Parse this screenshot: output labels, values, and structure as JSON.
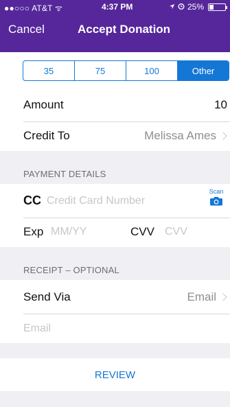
{
  "status_bar": {
    "carrier": "●●○○○ AT&T ᯤ",
    "time": "4:37 PM",
    "battery": "25%",
    "battery_level": 0.25
  },
  "nav": {
    "cancel": "Cancel",
    "title": "Accept Donation"
  },
  "amount_options": [
    "35",
    "75",
    "100",
    "Other"
  ],
  "selected_amount_option": "Other",
  "amount": {
    "label": "Amount",
    "value": "10"
  },
  "credit_to": {
    "label": "Credit To",
    "value": "Melissa Ames"
  },
  "payment_details": {
    "header": "PAYMENT DETAILS",
    "cc_label": "CC",
    "cc_placeholder": "Credit Card Number",
    "scan_label": "Scan",
    "exp_label": "Exp",
    "exp_placeholder": "MM/YY",
    "cvv_label": "CVV",
    "cvv_placeholder": "CVV"
  },
  "receipt": {
    "header": "RECEIPT – OPTIONAL",
    "send_via_label": "Send Via",
    "send_via_value": "Email",
    "email_placeholder": "Email"
  },
  "review_label": "REVIEW",
  "colors": {
    "nav_bg": "#55279a",
    "accent": "#1477d6",
    "page_bg": "#efeff4"
  }
}
